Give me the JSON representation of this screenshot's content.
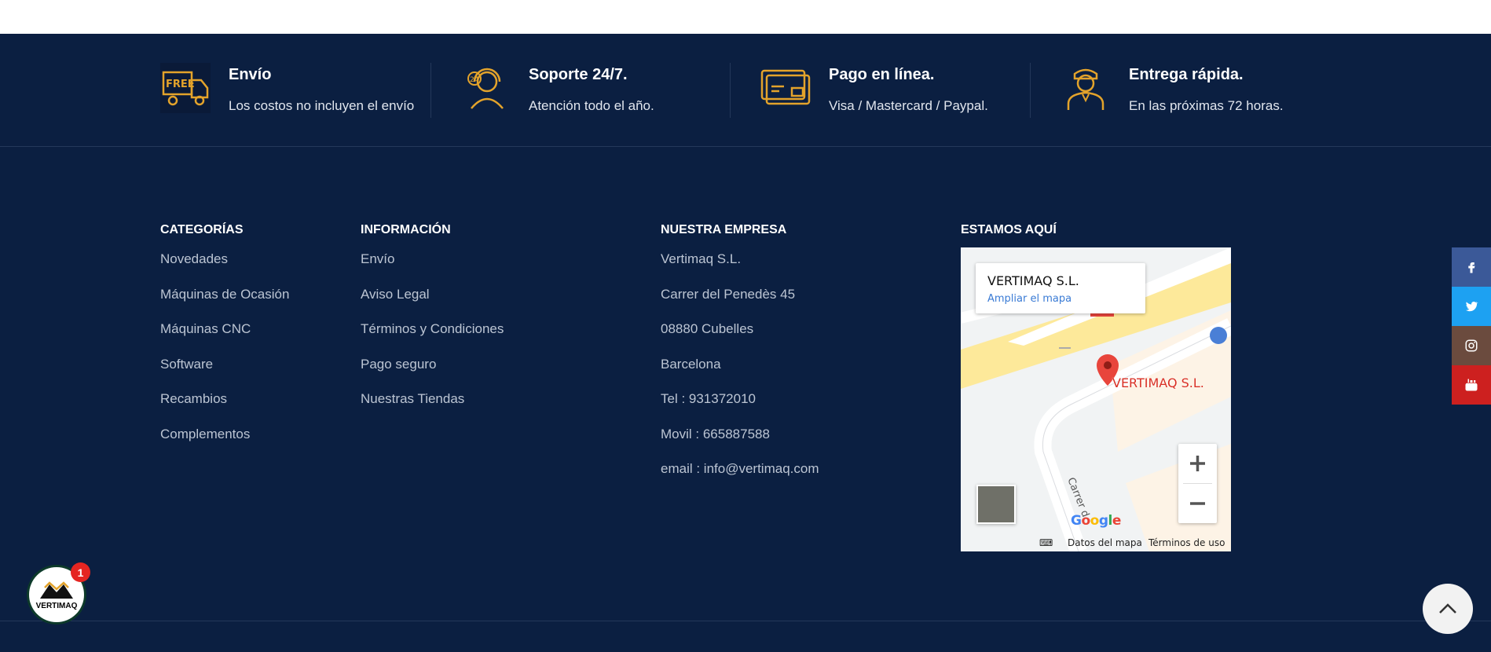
{
  "features": [
    {
      "title": "Envío",
      "subtitle": "Los costos no incluyen el envío",
      "icon": "free-delivery-truck-icon"
    },
    {
      "title": "Soporte 24/7.",
      "subtitle": "Atención todo el año.",
      "icon": "support-headset-icon"
    },
    {
      "title": "Pago en línea.",
      "subtitle": "Visa / Mastercard / Paypal.",
      "icon": "credit-card-icon"
    },
    {
      "title": "Entrega rápida.",
      "subtitle": "En las próximas 72 horas.",
      "icon": "delivery-person-icon"
    }
  ],
  "categories": {
    "heading": "CATEGORÍAS",
    "items": [
      "Novedades",
      "Máquinas de Ocasión",
      "Máquinas CNC",
      "Software",
      "Recambios",
      "Complementos"
    ]
  },
  "information": {
    "heading": "INFORMACIÓN",
    "items": [
      "Envío",
      "Aviso Legal",
      "Términos y Condiciones",
      "Pago seguro",
      "Nuestras Tiendas"
    ]
  },
  "company": {
    "heading": "NUESTRA EMPRESA",
    "lines": [
      "Vertimaq S.L.",
      "Carrer del Penedès 45",
      "08880 Cubelles",
      "Barcelona",
      "Tel : 931372010",
      "Movil : 665887588",
      "email : info@vertimaq.com"
    ]
  },
  "map": {
    "heading": "ESTAMOS AQUÍ",
    "place_name": "VERTIMAQ S.L.",
    "enlarge_link": "Ampliar el mapa",
    "pin_label": "VERTIMAQ S.L.",
    "street_label": "Carrer d",
    "zoom_in": "+",
    "zoom_out": "−",
    "map_data": "Datos del mapa",
    "terms": "Términos de uso",
    "logo": "Google"
  },
  "social": [
    {
      "name": "facebook",
      "color": "#3b5998",
      "glyph": "f"
    },
    {
      "name": "twitter",
      "color": "#1da1f2"
    },
    {
      "name": "instagram",
      "color": "#6b4b3e"
    },
    {
      "name": "youtube",
      "color": "#cd201f"
    }
  ],
  "chat_badge": {
    "brand": "VERTIMAQ",
    "count": "1"
  },
  "colors": {
    "accent": "#e3a32b",
    "background": "#0b1f41"
  }
}
